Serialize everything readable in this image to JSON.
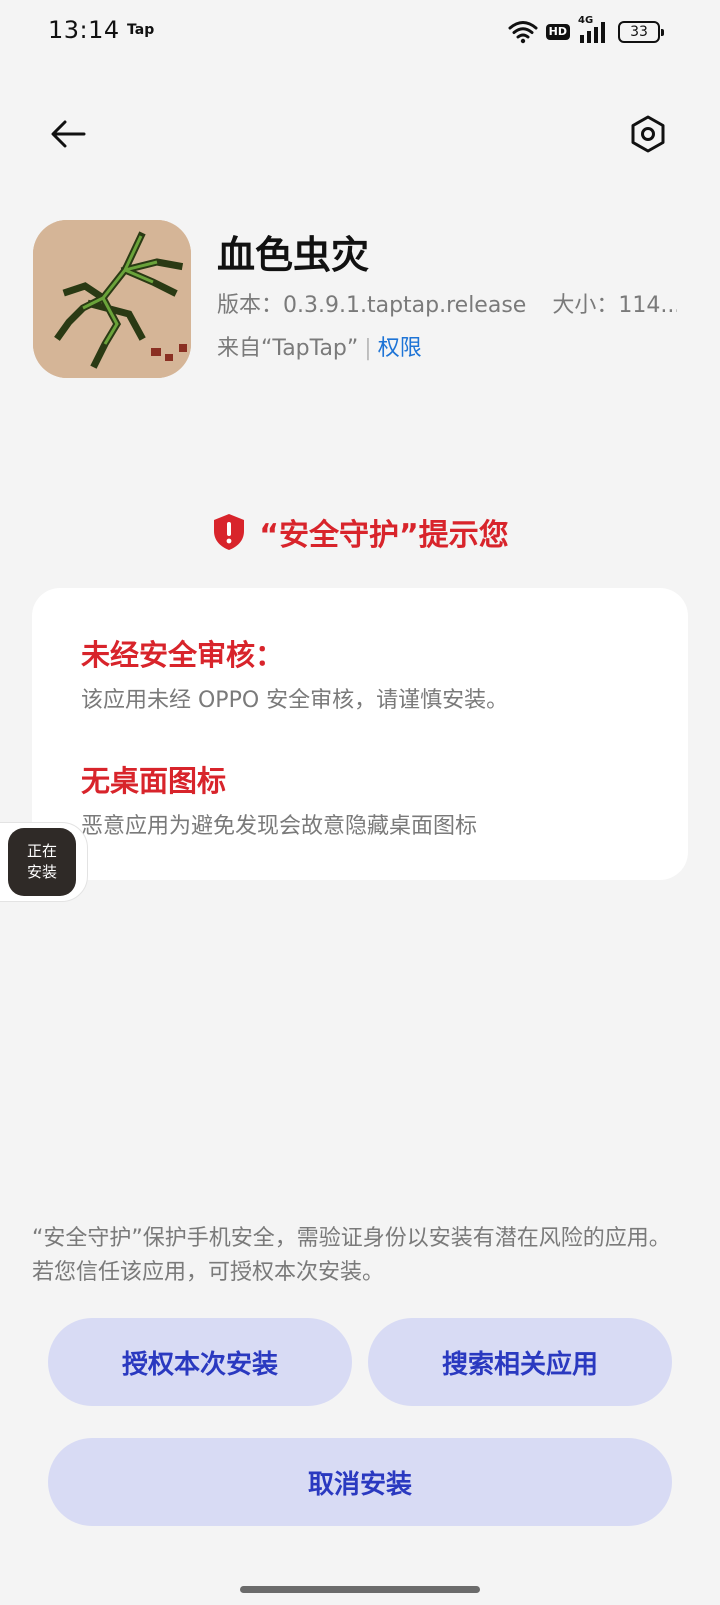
{
  "status_bar": {
    "time": "13:14",
    "app_indicator": "Tap",
    "hd_label": "HD",
    "network_label": "4G",
    "battery_level": "33",
    "icons": [
      "wifi-icon",
      "hd-icon",
      "signal-4g-icon",
      "battery-icon"
    ]
  },
  "nav": {
    "back_icon": "arrow-left-icon",
    "settings_icon": "hexagon-gear-icon"
  },
  "app": {
    "name": "血色虫灾",
    "version_text": "版本：0.3.9.1.taptap.release",
    "size_text": "大小：114...",
    "source_text": "来自“TapTap”",
    "source_divider": "|",
    "permissions_link": "权限"
  },
  "warning": {
    "headline": "“安全守护”提示您",
    "icon": "shield-exclamation-icon",
    "items": [
      {
        "title": "未经安全审核：",
        "desc": "该应用未经 OPPO 安全审核，请谨慎安装。"
      },
      {
        "title": "无桌面图标",
        "desc": "恶意应用为避免发现会故意隐藏桌面图标"
      }
    ]
  },
  "install_float": {
    "line1": "正在",
    "line2": "安装"
  },
  "footer_note": "“安全守护”保护手机安全，需验证身份以安装有潜在风险的应用。若您信任该应用，可授权本次安装。",
  "buttons": {
    "authorize": "授权本次安装",
    "search": "搜索相关应用",
    "cancel": "取消安装"
  },
  "colors": {
    "background": "#f4f4f4",
    "warning_red": "#d8242b",
    "link_blue": "#1e74d6",
    "button_bg": "#d8dbf4",
    "button_text": "#2a39c0"
  }
}
